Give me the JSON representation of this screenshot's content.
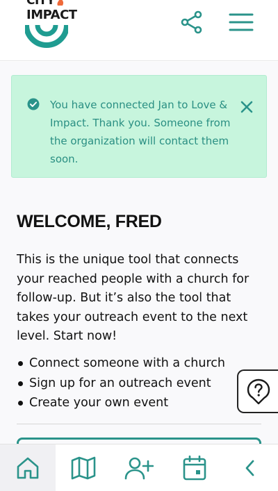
{
  "header": {
    "logo_line1": "CITY",
    "logo_line2": "IMPACT",
    "share_icon": "share-icon",
    "menu_icon": "hamburger-menu-icon"
  },
  "alert": {
    "message": "You have connected Jan to Love & Impact. Thank you. Someone from the organization will contact them soon.",
    "icon": "check-circle-icon",
    "close_icon": "close-icon"
  },
  "main": {
    "welcome": "WELCOME, FRED",
    "intro": "This is the unique tool that connects your reached people with a church for follow-up. But it’s also the tool that takes your outreach event to the next level. Start now!",
    "bullets": [
      "Connect someone with a church",
      "Sign up for an outreach event",
      "Create your own event"
    ]
  },
  "help": {
    "icon": "help-question-icon"
  },
  "nav": {
    "items": [
      "home-icon",
      "map-icon",
      "add-user-icon",
      "calendar-icon",
      "chevron-left-icon"
    ]
  },
  "colors": {
    "accent": "#2a938a",
    "alert_bg": "#c7f5dd",
    "alert_text": "#2a8f83"
  }
}
